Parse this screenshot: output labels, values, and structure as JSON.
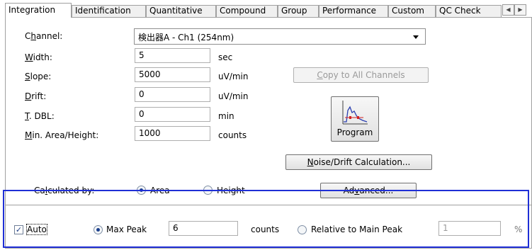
{
  "tabs": [
    {
      "label": "Integration",
      "active": true
    },
    {
      "label": "Identification",
      "active": false
    },
    {
      "label": "Quantitative",
      "active": false
    },
    {
      "label": "Compound",
      "active": false
    },
    {
      "label": "Group",
      "active": false
    },
    {
      "label": "Performance",
      "active": false
    },
    {
      "label": "Custom",
      "active": false
    },
    {
      "label": "QC Check",
      "active": false
    }
  ],
  "tab_scroll": {
    "left": "◀",
    "right": "▶"
  },
  "channel": {
    "label_pre": "C",
    "label_u": "h",
    "label_post": "annel:",
    "value": "検出器A - Ch1 (254nm)"
  },
  "params": [
    {
      "u": "W",
      "rest": "idth:",
      "value": "5",
      "unit": "sec"
    },
    {
      "u": "S",
      "rest": "lope:",
      "value": "5000",
      "unit": "uV/min"
    },
    {
      "u": "D",
      "rest": "rift:",
      "value": "0",
      "unit": "uV/min"
    },
    {
      "u": "T",
      "rest": ". DBL:",
      "value": "0",
      "unit": "min"
    },
    {
      "u": "M",
      "rest": "in. Area/Height:",
      "value": "1000",
      "unit": "counts"
    }
  ],
  "copy_button": {
    "u": "C",
    "rest": "opy to All Channels"
  },
  "program_button": {
    "label": "Program"
  },
  "noise_button": {
    "u": "N",
    "rest": "oise/Drift Calculation..."
  },
  "calculated_by": {
    "label_pre": "Ca",
    "label_u": "l",
    "label_post": "culated by:",
    "options": [
      "Area",
      "Height"
    ],
    "selected": "Area"
  },
  "advanced_button": {
    "pre": "Ad",
    "u": "v",
    "post": "anced..."
  },
  "auto_section": {
    "auto_label": "Auto",
    "auto_checked": true,
    "max_peak_label": "Max Peak",
    "max_peak_value": "6",
    "counts_label": "counts",
    "relative_label": "Relative to Main Peak",
    "relative_value": "1",
    "percent_label": "%"
  },
  "colors": {
    "highlight_frame": "#1f2fd6",
    "radio_dot": "#1b3f8c"
  }
}
